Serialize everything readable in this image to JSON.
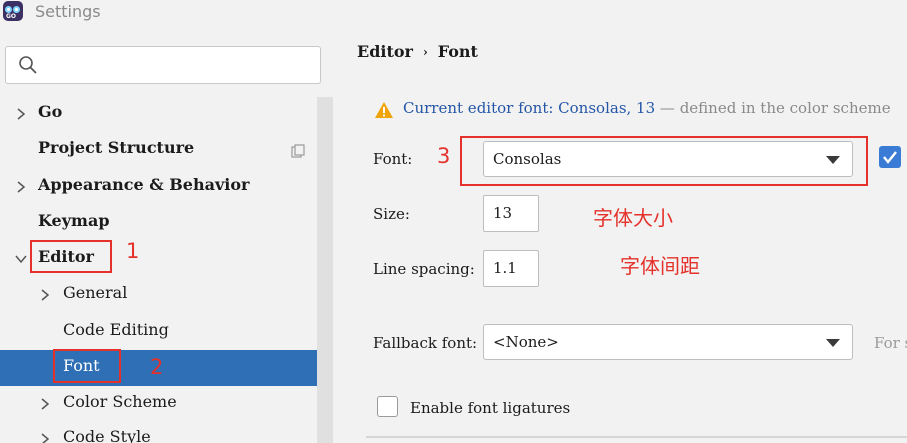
{
  "window": {
    "title": "Settings",
    "app_icon": "goland-icon",
    "app_icon_text": "GO"
  },
  "search": {
    "placeholder": "",
    "icon": "search-icon"
  },
  "tree": [
    {
      "label": "Go",
      "expandable": true,
      "expanded": false,
      "bold": true
    },
    {
      "label": "Project Structure",
      "expandable": false,
      "bold": true,
      "trailing_icon": "copy-icon"
    },
    {
      "label": "Appearance & Behavior",
      "expandable": true,
      "expanded": false,
      "bold": true
    },
    {
      "label": "Keymap",
      "expandable": false,
      "bold": true
    },
    {
      "label": "Editor",
      "expandable": true,
      "expanded": true,
      "bold": true
    },
    {
      "label": "General",
      "expandable": true,
      "expanded": false,
      "bold": false
    },
    {
      "label": "Code Editing",
      "expandable": false,
      "bold": false
    },
    {
      "label": "Font",
      "expandable": false,
      "bold": false,
      "selected": true
    },
    {
      "label": "Color Scheme",
      "expandable": true,
      "expanded": false,
      "bold": false
    },
    {
      "label": "Code Style",
      "expandable": true,
      "expanded": false,
      "bold": false
    }
  ],
  "breadcrumb": {
    "parent": "Editor",
    "separator": "›",
    "current": "Font"
  },
  "warning": {
    "icon": "warning-icon",
    "link_text": "Current editor font: Consolas, 13",
    "muted_text": "— defined in the color scheme"
  },
  "font_settings": {
    "font_label": "Font:",
    "font_value": "Consolas",
    "show_only_monospaced_checked": true,
    "size_label": "Size:",
    "size_value": "13",
    "line_spacing_label": "Line spacing:",
    "line_spacing_value": "1.1",
    "fallback_label": "Fallback font:",
    "fallback_value": "<None>",
    "fallback_hint": "For s",
    "ligatures_label": "Enable font ligatures",
    "ligatures_checked": false
  },
  "annotations": {
    "n1": "1",
    "n2": "2",
    "n3": "3",
    "size_note": "字体大小",
    "spacing_note": "字体间距"
  },
  "colors": {
    "selection": "#2f6fb6",
    "annotation": "#e4312b",
    "link": "#2456a8",
    "checkbox_accent": "#3a7bd5"
  }
}
